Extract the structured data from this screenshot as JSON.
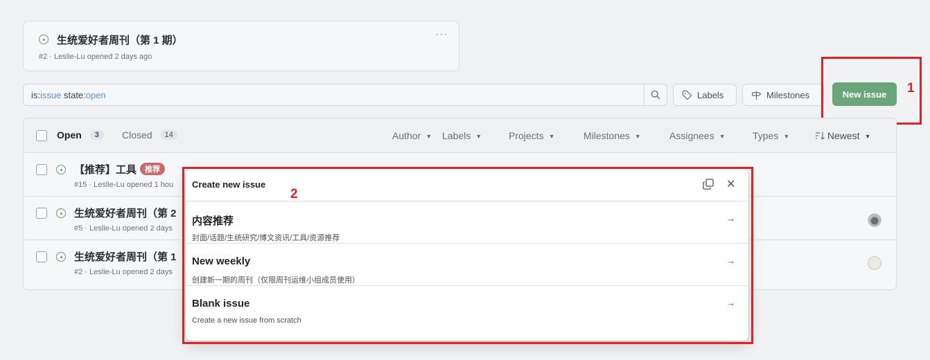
{
  "pinned": {
    "title": "生统爱好者周刊（第 1 期）",
    "meta": "#2 · Leslie-Lu opened 2 days ago",
    "more": "···"
  },
  "search": {
    "prefix1": "is:",
    "kw1": "issue",
    "prefix2": " state:",
    "kw2": "open"
  },
  "toolbar": {
    "labels": "Labels",
    "milestones": "Milestones",
    "new_issue": "New issue"
  },
  "list": {
    "open_label": "Open",
    "open_count": "3",
    "closed_label": "Closed",
    "closed_count": "14",
    "filters": [
      "Author",
      "Labels",
      "Projects",
      "Milestones",
      "Assignees",
      "Types"
    ],
    "sort": "Newest",
    "issues": [
      {
        "title": "【推荐】工具",
        "badge": "推荐",
        "meta": "#15 · Leslie-Lu opened 1 hou"
      },
      {
        "title": "生统爱好者周刊（第 2",
        "badge": "",
        "meta": "#5 · Leslie-Lu opened 2 days"
      },
      {
        "title": "生统爱好者周刊（第 1",
        "badge": "",
        "meta": "#2 · Leslie-Lu opened 2 days"
      }
    ]
  },
  "modal": {
    "title": "Create new issue",
    "templates": [
      {
        "name": "内容推荐",
        "desc": "封面/话题/生统研究/博文资讯/工具/资源推荐"
      },
      {
        "name": "New weekly",
        "desc": "创建新一期的周刊（仅限周刊运维小组成员使用）"
      },
      {
        "name": "Blank issue",
        "desc": "Create a new issue from scratch"
      }
    ]
  },
  "annotations": {
    "n1": "1",
    "n2": "2"
  },
  "colors": {
    "accent_green": "#6aa67a",
    "annotation_red": "#e0212a",
    "badge_red": "#c96b6e"
  }
}
